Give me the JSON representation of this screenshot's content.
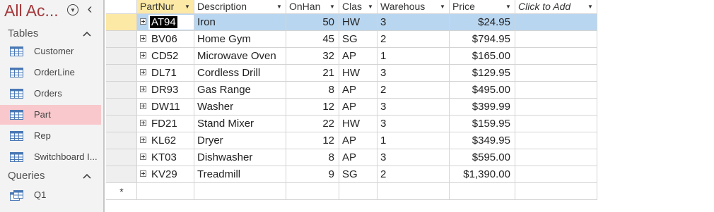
{
  "nav": {
    "title": "All Ac...",
    "groups": [
      {
        "label": "Tables",
        "items": [
          {
            "label": "Customer",
            "icon": "table-icon",
            "selected": false
          },
          {
            "label": "OrderLine",
            "icon": "table-icon",
            "selected": false
          },
          {
            "label": "Orders",
            "icon": "table-icon",
            "selected": false
          },
          {
            "label": "Part",
            "icon": "table-icon",
            "selected": true
          },
          {
            "label": "Rep",
            "icon": "table-icon",
            "selected": false
          },
          {
            "label": "Switchboard I...",
            "icon": "table-icon",
            "selected": false
          }
        ]
      },
      {
        "label": "Queries",
        "items": [
          {
            "label": "Q1",
            "icon": "query-icon",
            "selected": false
          }
        ]
      }
    ]
  },
  "sheet": {
    "columns": [
      {
        "label": "PartNur",
        "has_arrow": true,
        "selected": true
      },
      {
        "label": "Description",
        "has_arrow": true,
        "selected": false
      },
      {
        "label": "OnHan",
        "has_arrow": true,
        "selected": false
      },
      {
        "label": "Clas",
        "has_arrow": true,
        "selected": false
      },
      {
        "label": "Warehous",
        "has_arrow": true,
        "selected": false
      },
      {
        "label": "Price",
        "has_arrow": true,
        "selected": false
      },
      {
        "label": "Click to Add",
        "has_arrow": true,
        "selected": false,
        "italic": true
      }
    ],
    "rows": [
      {
        "part": "AT94",
        "desc": "Iron",
        "onhand": "50",
        "class": "HW",
        "warehouse": "3",
        "price": "$24.95",
        "current": true
      },
      {
        "part": "BV06",
        "desc": "Home Gym",
        "onhand": "45",
        "class": "SG",
        "warehouse": "2",
        "price": "$794.95"
      },
      {
        "part": "CD52",
        "desc": "Microwave Oven",
        "onhand": "32",
        "class": "AP",
        "warehouse": "1",
        "price": "$165.00"
      },
      {
        "part": "DL71",
        "desc": "Cordless Drill",
        "onhand": "21",
        "class": "HW",
        "warehouse": "3",
        "price": "$129.95"
      },
      {
        "part": "DR93",
        "desc": "Gas Range",
        "onhand": "8",
        "class": "AP",
        "warehouse": "2",
        "price": "$495.00"
      },
      {
        "part": "DW11",
        "desc": "Washer",
        "onhand": "12",
        "class": "AP",
        "warehouse": "3",
        "price": "$399.99"
      },
      {
        "part": "FD21",
        "desc": "Stand Mixer",
        "onhand": "22",
        "class": "HW",
        "warehouse": "3",
        "price": "$159.95"
      },
      {
        "part": "KL62",
        "desc": "Dryer",
        "onhand": "12",
        "class": "AP",
        "warehouse": "1",
        "price": "$349.95"
      },
      {
        "part": "KT03",
        "desc": "Dishwasher",
        "onhand": "8",
        "class": "AP",
        "warehouse": "3",
        "price": "$595.00"
      },
      {
        "part": "KV29",
        "desc": "Treadmill",
        "onhand": "9",
        "class": "SG",
        "warehouse": "2",
        "price": "$1,390.00"
      }
    ],
    "new_row_symbol": "*"
  },
  "colors": {
    "nav_title": "#a4373a",
    "selected_nav_item": "#f8c8cc",
    "current_row": "#b9d6f0",
    "selected_header": "#fce9a6"
  }
}
